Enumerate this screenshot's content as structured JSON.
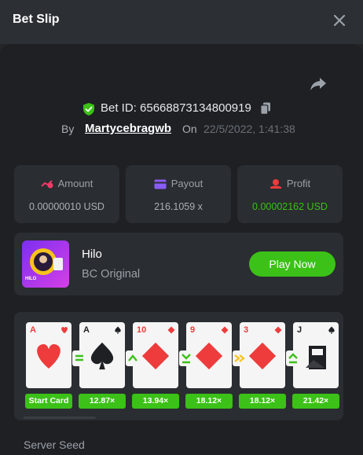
{
  "header": {
    "title": "Bet Slip"
  },
  "bet": {
    "id_text": "Bet ID: 65668873134800919",
    "by_label": "By",
    "username": "Martycebragwb",
    "on_label": "On",
    "date": "22/5/2022, 1:41:38"
  },
  "stats": {
    "amount": {
      "label": "Amount",
      "value": "0.00000010 USD"
    },
    "payout": {
      "label": "Payout",
      "value": "216.1059 x"
    },
    "profit": {
      "label": "Profit",
      "value": "0.00002162 USD"
    }
  },
  "game": {
    "name": "Hilo",
    "provider": "BC Original",
    "thumb_caption": "HILO",
    "play_label": "Play Now"
  },
  "cards": [
    {
      "rank": "A",
      "suit": "heart",
      "multiplier": "Start Card"
    },
    {
      "rank": "A",
      "suit": "spade",
      "multiplier": "12.87×"
    },
    {
      "rank": "10",
      "suit": "diamond",
      "multiplier": "13.94×"
    },
    {
      "rank": "9",
      "suit": "diamond",
      "multiplier": "18.12×"
    },
    {
      "rank": "3",
      "suit": "diamond",
      "multiplier": "18.12×"
    },
    {
      "rank": "J",
      "suit": "spade",
      "multiplier": "21.42×"
    }
  ],
  "guesses": [
    "equal",
    "higher",
    "lower-or-equal",
    "skip",
    "higher-or-equal"
  ],
  "seed": {
    "label": "Server Seed"
  },
  "colors": {
    "accent_green": "#3bc117",
    "profit_green": "#3bc117",
    "panel": "#2a2d31",
    "heart_red": "#ee3b3b",
    "spade_dark": "#1e2024"
  }
}
